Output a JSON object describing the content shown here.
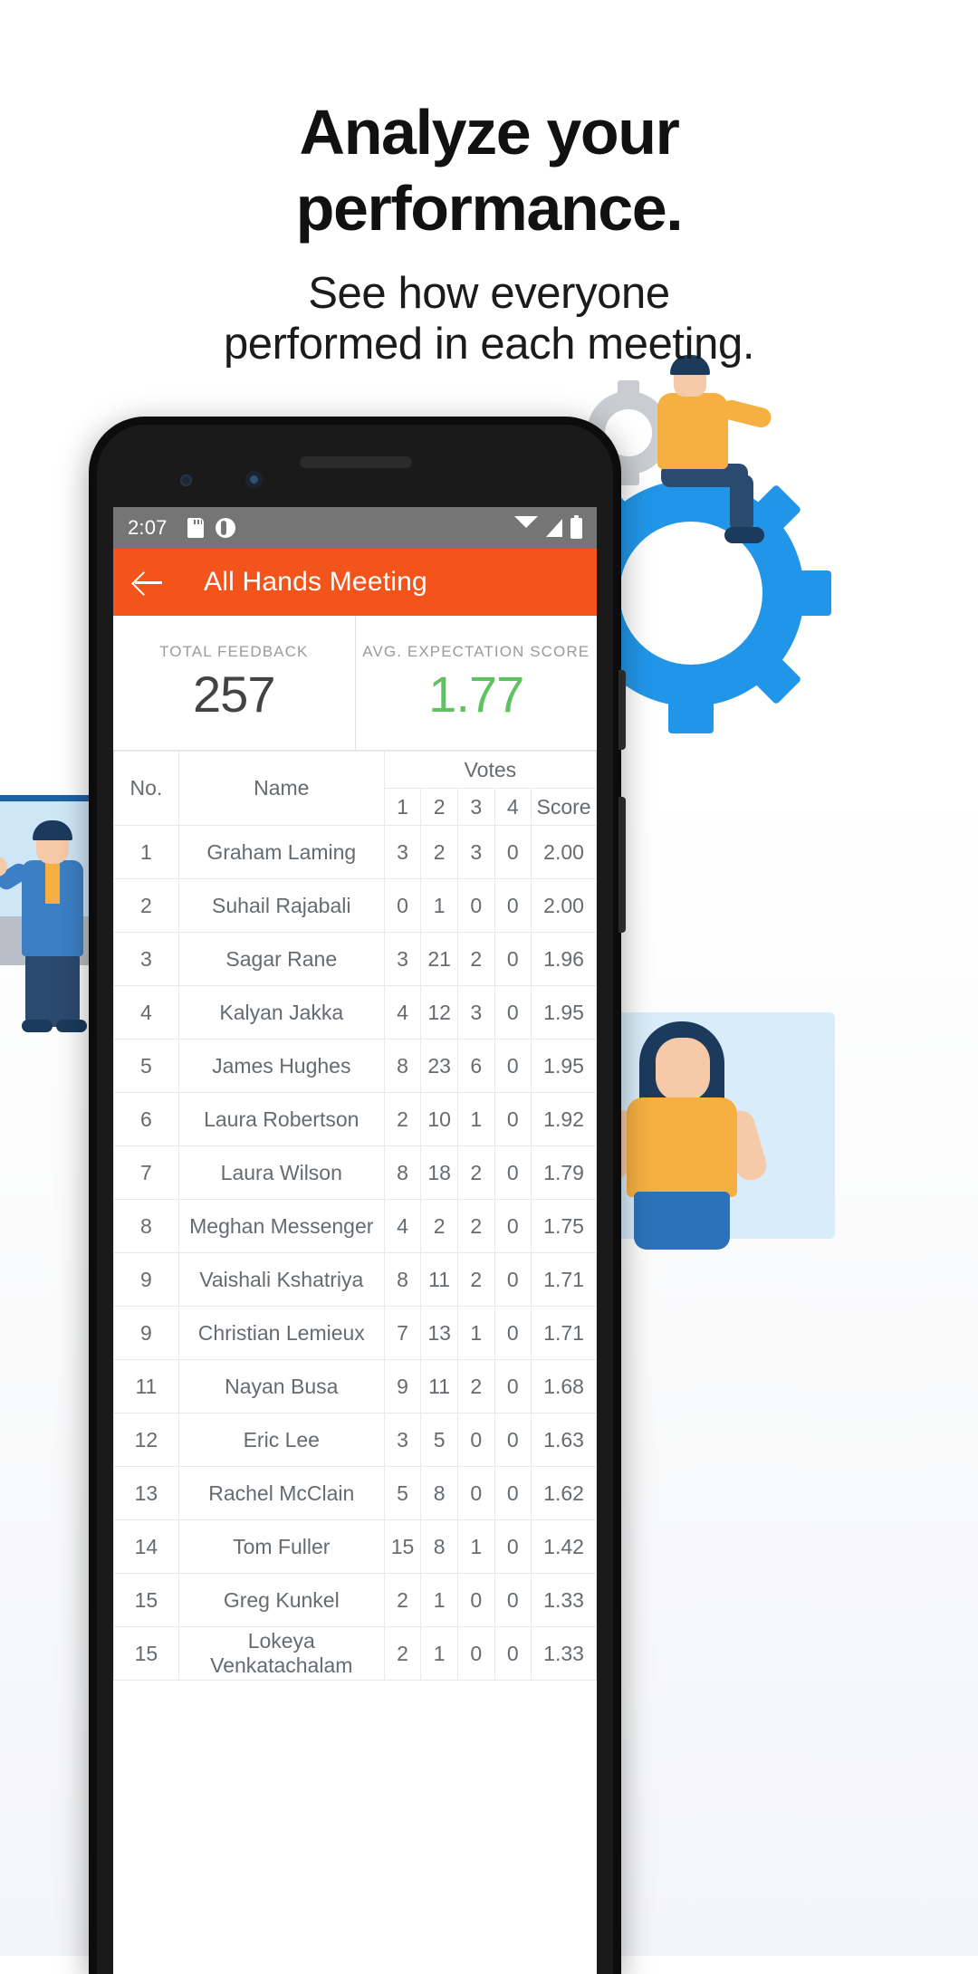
{
  "promo": {
    "headline_line1": "Analyze your",
    "headline_line2": "performance.",
    "subhead_line1": "See how everyone",
    "subhead_line2": "performed in each meeting."
  },
  "phone": {
    "statusbar": {
      "time": "2:07",
      "icons_left": [
        "sd-card-icon",
        "alarm-icon"
      ],
      "icons_right": [
        "wifi-icon",
        "signal-icon",
        "battery-icon"
      ],
      "background": "#757575"
    },
    "appbar": {
      "back_icon": "back-arrow-icon",
      "title": "All Hands Meeting",
      "background": "#f2541b"
    },
    "stats": [
      {
        "label": "TOTAL FEEDBACK",
        "value": "257",
        "color": "#434343"
      },
      {
        "label": "AVG. EXPECTATION SCORE",
        "value": "1.77",
        "color": "#5fc15f"
      }
    ],
    "table": {
      "headers": {
        "no": "No.",
        "name": "Name",
        "votes_group": "Votes",
        "v1": "1",
        "v2": "2",
        "v3": "3",
        "v4": "4",
        "score": "Score"
      },
      "link_color": "#4ea9e8",
      "rows": [
        {
          "no": "1",
          "name": "Graham Laming",
          "v1": "3",
          "v2": "2",
          "v3": "3",
          "v4": "0",
          "score": "2.00"
        },
        {
          "no": "2",
          "name": "Suhail Rajabali",
          "v1": "0",
          "v2": "1",
          "v3": "0",
          "v4": "0",
          "score": "2.00"
        },
        {
          "no": "3",
          "name": "Sagar Rane",
          "v1": "3",
          "v2": "21",
          "v3": "2",
          "v4": "0",
          "score": "1.96"
        },
        {
          "no": "4",
          "name": "Kalyan Jakka",
          "v1": "4",
          "v2": "12",
          "v3": "3",
          "v4": "0",
          "score": "1.95"
        },
        {
          "no": "5",
          "name": "James Hughes",
          "v1": "8",
          "v2": "23",
          "v3": "6",
          "v4": "0",
          "score": "1.95"
        },
        {
          "no": "6",
          "name": "Laura Robertson",
          "v1": "2",
          "v2": "10",
          "v3": "1",
          "v4": "0",
          "score": "1.92"
        },
        {
          "no": "7",
          "name": "Laura Wilson",
          "v1": "8",
          "v2": "18",
          "v3": "2",
          "v4": "0",
          "score": "1.79"
        },
        {
          "no": "8",
          "name": "Meghan Messenger",
          "v1": "4",
          "v2": "2",
          "v3": "2",
          "v4": "0",
          "score": "1.75"
        },
        {
          "no": "9",
          "name": "Vaishali Kshatriya",
          "v1": "8",
          "v2": "11",
          "v3": "2",
          "v4": "0",
          "score": "1.71"
        },
        {
          "no": "9",
          "name": "Christian Lemieux",
          "v1": "7",
          "v2": "13",
          "v3": "1",
          "v4": "0",
          "score": "1.71"
        },
        {
          "no": "11",
          "name": "Nayan Busa",
          "v1": "9",
          "v2": "11",
          "v3": "2",
          "v4": "0",
          "score": "1.68"
        },
        {
          "no": "12",
          "name": "Eric Lee",
          "v1": "3",
          "v2": "5",
          "v3": "0",
          "v4": "0",
          "score": "1.63"
        },
        {
          "no": "13",
          "name": "Rachel McClain",
          "v1": "5",
          "v2": "8",
          "v3": "0",
          "v4": "0",
          "score": "1.62"
        },
        {
          "no": "14",
          "name": "Tom Fuller",
          "v1": "15",
          "v2": "8",
          "v3": "1",
          "v4": "0",
          "score": "1.42"
        },
        {
          "no": "15",
          "name": "Greg Kunkel",
          "v1": "2",
          "v2": "1",
          "v3": "0",
          "v4": "0",
          "score": "1.33"
        },
        {
          "no": "15",
          "name": "Lokeya Venkatachalam",
          "v1": "2",
          "v2": "1",
          "v3": "0",
          "v4": "0",
          "score": "1.33"
        }
      ]
    }
  }
}
